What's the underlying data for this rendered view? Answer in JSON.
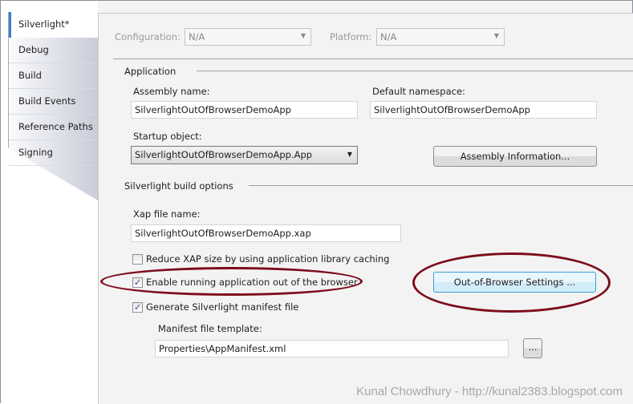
{
  "tabs": [
    "Silverlight*",
    "Debug",
    "Build",
    "Build Events",
    "Reference Paths",
    "Signing"
  ],
  "config": {
    "configuration_label": "Configuration:",
    "configuration_value": "N/A",
    "platform_label": "Platform:",
    "platform_value": "N/A"
  },
  "application": {
    "heading": "Application",
    "assembly_label": "Assembly name:",
    "assembly_value": "SilverlightOutOfBrowserDemoApp",
    "namespace_label": "Default namespace:",
    "namespace_value": "SilverlightOutOfBrowserDemoApp",
    "startup_label": "Startup object:",
    "startup_value": "SilverlightOutOfBrowserDemoApp.App",
    "assembly_info_button": "Assembly Information..."
  },
  "build_options": {
    "heading": "Silverlight build options",
    "xap_label": "Xap file name:",
    "xap_value": "SilverlightOutOfBrowserDemoApp.xap",
    "reduce_xap": "Reduce XAP size by using application library caching",
    "reduce_xap_checked": false,
    "enable_oob": "Enable running application out of the browser",
    "enable_oob_checked": true,
    "oob_settings_button": "Out-of-Browser Settings ...",
    "generate_manifest": "Generate Silverlight manifest file",
    "generate_manifest_checked": true,
    "manifest_label": "Manifest file template:",
    "manifest_value": "Properties\\AppManifest.xml",
    "browse_button": "..."
  },
  "watermark": "Kunal Chowdhury - http://kunal2383.blogspot.com",
  "annotation_color": "#7d0c1c"
}
